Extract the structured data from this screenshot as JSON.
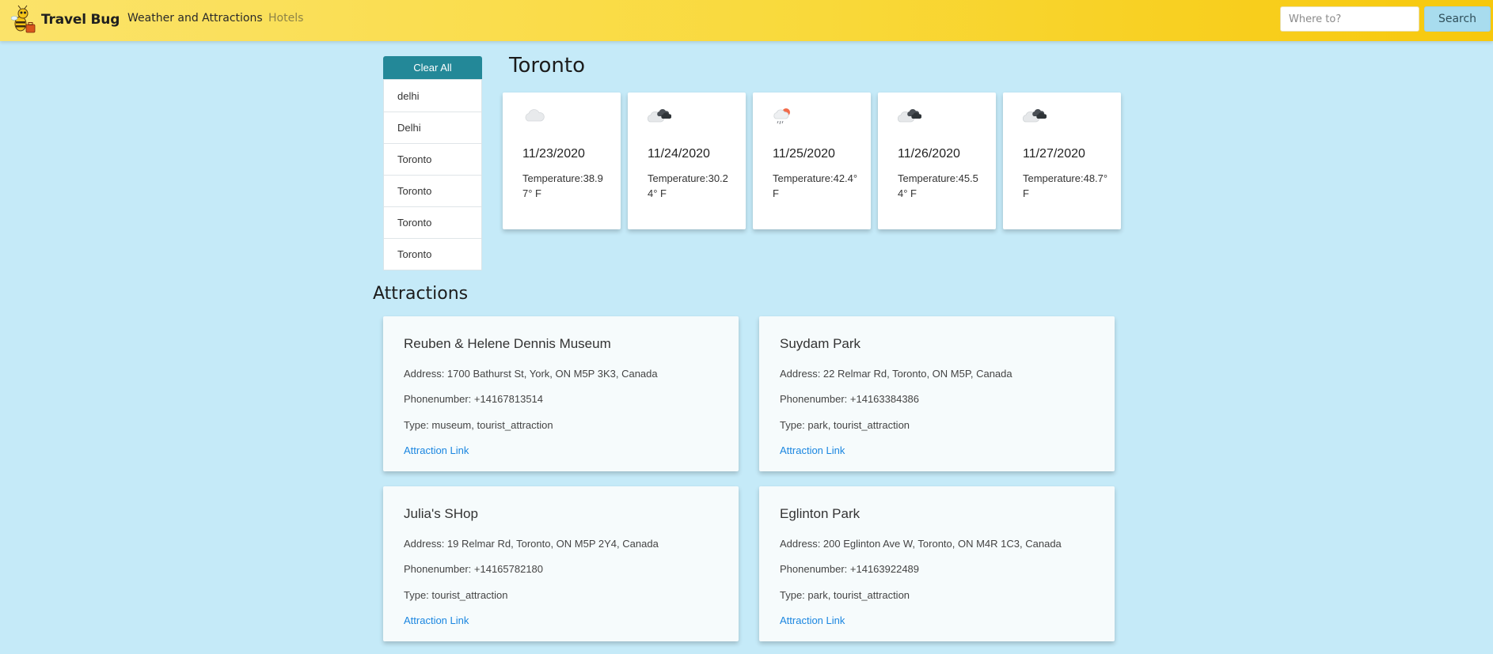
{
  "navbar": {
    "brand": "Travel Bug",
    "links": [
      "Weather and Attractions",
      "Hotels"
    ],
    "search_placeholder": "Where to?",
    "search_button": "Search",
    "colors": {
      "gradient_start": "#fbe36a",
      "gradient_end": "#f7c80c"
    }
  },
  "history": {
    "clear_label": "Clear All",
    "items": [
      "delhi",
      "Delhi",
      "Toronto",
      "Toronto",
      "Toronto",
      "Toronto"
    ]
  },
  "weather": {
    "city": "Toronto",
    "forecast": [
      {
        "date": "11/23/2020",
        "temperature": "Temperature:38.97° F",
        "icon": "cloud-icon"
      },
      {
        "date": "11/24/2020",
        "temperature": "Temperature:30.24° F",
        "icon": "dark-clouds-icon"
      },
      {
        "date": "11/25/2020",
        "temperature": "Temperature:42.4° F",
        "icon": "sun-rain-cloud-icon"
      },
      {
        "date": "11/26/2020",
        "temperature": "Temperature:45.54° F",
        "icon": "dark-clouds-icon"
      },
      {
        "date": "11/27/2020",
        "temperature": "Temperature:48.7° F",
        "icon": "dark-clouds-icon"
      }
    ]
  },
  "attractions": {
    "heading": "Attractions",
    "link_label": "Attraction Link",
    "items": [
      {
        "name": "Reuben & Helene Dennis Museum",
        "address": "Address: 1700 Bathurst St, York, ON M5P 3K3, Canada",
        "phone": "Phonenumber: +14167813514",
        "type": "Type: museum, tourist_attraction"
      },
      {
        "name": "Suydam Park",
        "address": "Address: 22 Relmar Rd, Toronto, ON M5P, Canada",
        "phone": "Phonenumber: +14163384386",
        "type": "Type: park, tourist_attraction"
      },
      {
        "name": "Julia's SHop",
        "address": "Address: 19 Relmar Rd, Toronto, ON M5P 2Y4, Canada",
        "phone": "Phonenumber: +14165782180",
        "type": "Type: tourist_attraction"
      },
      {
        "name": "Eglinton Park",
        "address": "Address: 200 Eglinton Ave W, Toronto, ON M4R 1C3, Canada",
        "phone": "Phonenumber: +14163922489",
        "type": "Type: park, tourist_attraction"
      }
    ]
  },
  "colors": {
    "page_background": "#c5eaf8",
    "clear_button": "#238898",
    "link": "#1a86e0",
    "search_button": "#a8dcee"
  }
}
